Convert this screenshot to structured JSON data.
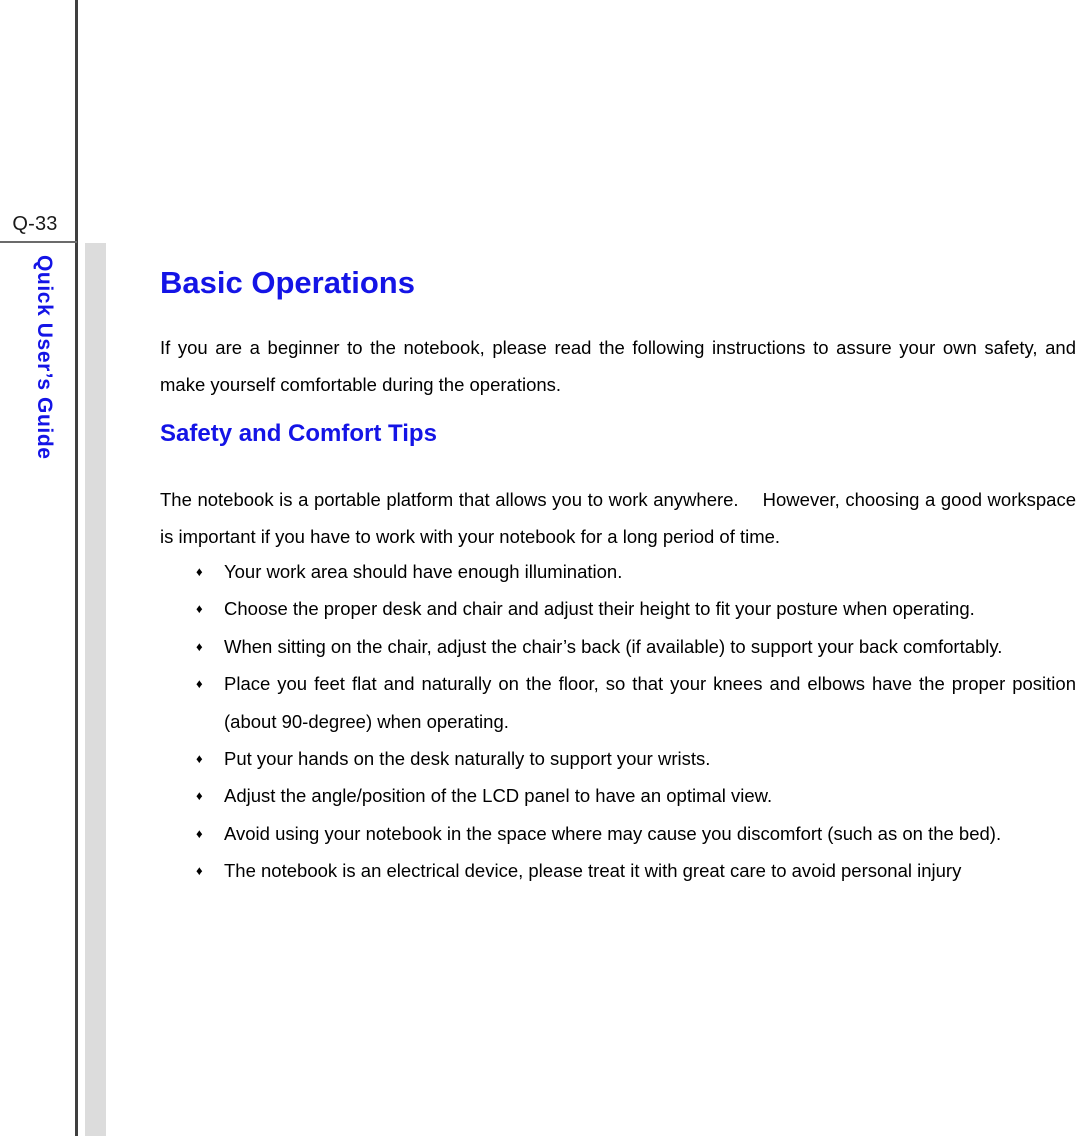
{
  "page": {
    "page_number": "Q-33",
    "sidebar_title": "Quick User’s Guide",
    "accent_color": "#1414e6",
    "band_color": "#dcdcdc",
    "rule_color": "#3f3f3f"
  },
  "content": {
    "title": "Basic Operations",
    "intro_paragraph": "If you are a beginner to the notebook, please read the following instructions to assure your own safety, and make yourself comfortable during the operations.",
    "section_heading": "Safety and Comfort Tips",
    "lead_paragraph": "The notebook is a portable platform that allows you to work anywhere.  However, choosing a good workspace is important if you have to work with your notebook for a long period of time.",
    "bullet_glyph": "♦",
    "tips": [
      "Your work area should have enough illumination.",
      "Choose the proper desk and chair and adjust their height to fit your posture when operating.",
      "When sitting on the chair, adjust the chair’s back (if available) to support your back comfortably.",
      "Place you feet flat and naturally on the floor, so that your knees and elbows have the proper position (about 90-degree) when operating.",
      "Put your hands on the desk naturally to support your wrists.",
      "Adjust the angle/position of the LCD panel to have an optimal view.",
      "Avoid using your notebook in the space where may cause you discomfort (such as on the bed).",
      "The notebook is an electrical device, please treat it with great care to avoid personal injury"
    ]
  }
}
